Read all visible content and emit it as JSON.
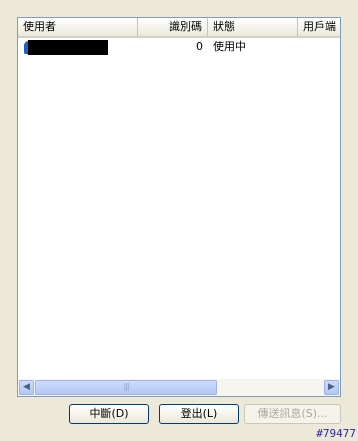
{
  "columns": {
    "user": "使用者",
    "id": "識別碼",
    "status": "狀態",
    "account": "用戶端"
  },
  "rows": [
    {
      "user": "",
      "id": "0",
      "status": "使用中"
    }
  ],
  "buttons": {
    "pause": "中斷(D)",
    "logout": "登出(L)",
    "send": "傳送訊息(S)..."
  },
  "scrollbar": {
    "left_arrow": "◀",
    "right_arrow": "▶",
    "thumb_grip": "|||"
  },
  "watermark": "#79477"
}
